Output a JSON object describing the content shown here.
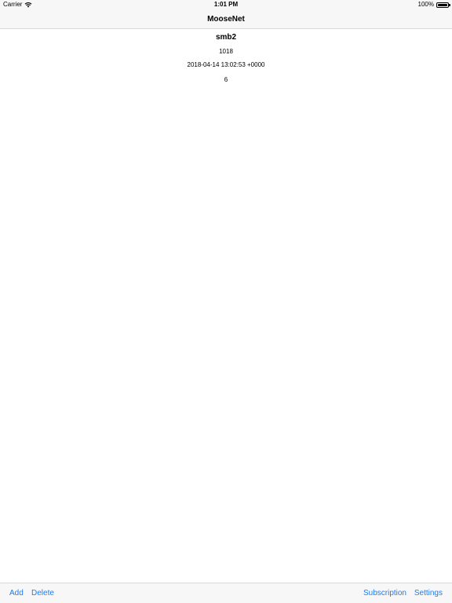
{
  "status_bar": {
    "carrier": "Carrier",
    "time": "1:01 PM",
    "battery_percent": "100%",
    "battery_level": 1.0,
    "wifi_icon": "wifi-icon",
    "battery_icon": "battery-icon"
  },
  "nav": {
    "title": "MooseNet"
  },
  "item": {
    "name": "smb2",
    "id": "1018",
    "timestamp": "2018-04-14 13:02:53 +0000",
    "count": "6"
  },
  "toolbar": {
    "add_label": "Add",
    "delete_label": "Delete",
    "subscription_label": "Subscription",
    "settings_label": "Settings"
  },
  "colors": {
    "accent": "#1a7cf5",
    "bar_background": "#f7f7f7"
  }
}
